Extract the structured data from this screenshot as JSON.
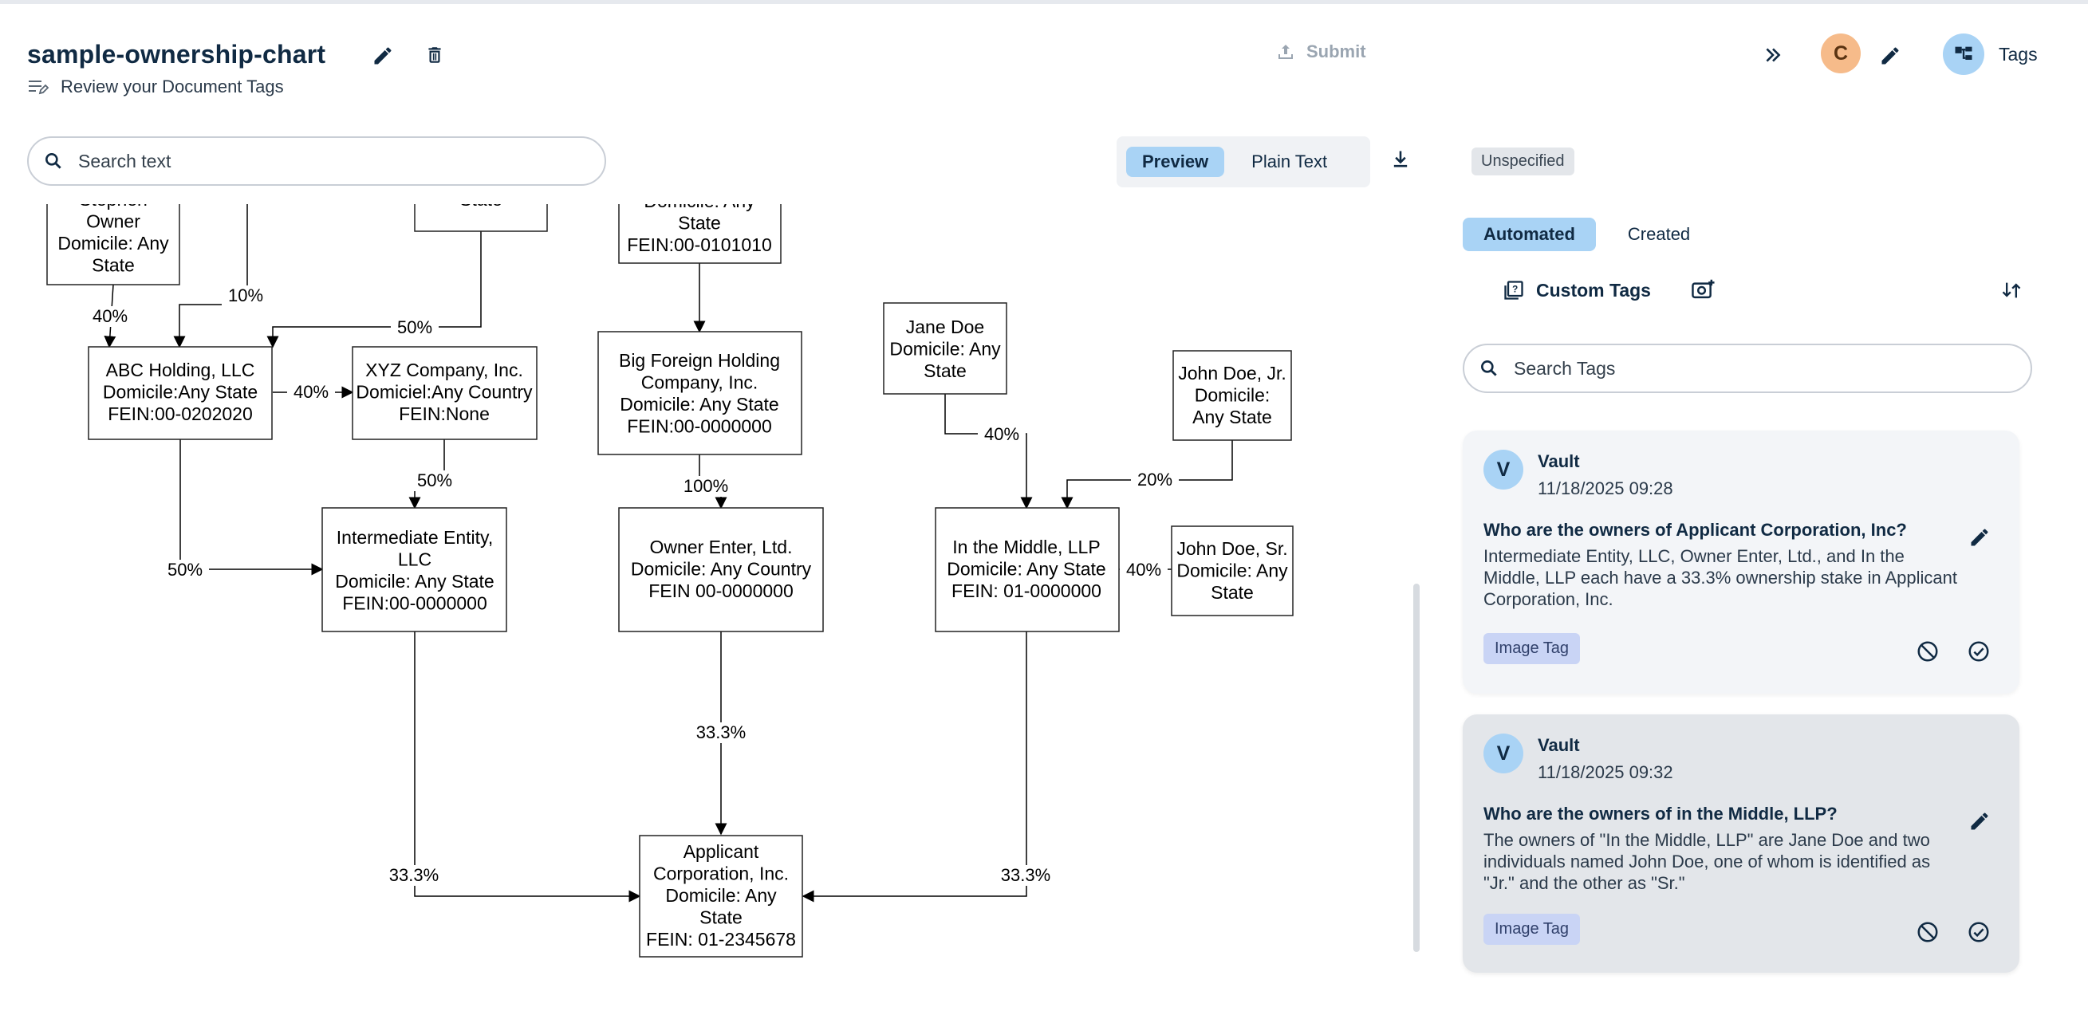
{
  "header": {
    "title": "sample-ownership-chart",
    "review_label": "Review your Document Tags",
    "submit_label": "Submit",
    "avatar_initial": "C",
    "tags_label": "Tags"
  },
  "toolbar": {
    "search_placeholder": "Search text",
    "preview_label": "Preview",
    "plain_text_label": "Plain Text"
  },
  "chart": {
    "boxes": {
      "stephen": [
        "Stephen",
        "Owner",
        "Domicile: Any",
        "State"
      ],
      "top_mid": [
        "State"
      ],
      "top_foreign": [
        "Domicile: Any",
        "State",
        "FEIN:00-0101010"
      ],
      "abc": [
        "ABC Holding, LLC",
        "Domicile:Any State",
        "FEIN:00-0202020"
      ],
      "xyz": [
        "XYZ Company, Inc.",
        "Domiciel:Any Country",
        "FEIN:None"
      ],
      "big_foreign": [
        "Big Foreign Holding",
        "Company, Inc.",
        "Domicile: Any State",
        "FEIN:00-0000000"
      ],
      "jane": [
        "Jane Doe",
        "Domicile: Any",
        "State"
      ],
      "john_jr": [
        "John Doe, Jr.",
        "Domicile:",
        "Any State"
      ],
      "intermediate": [
        "Intermediate Entity,",
        "LLC",
        "Domicile: Any State",
        "FEIN:00-0000000"
      ],
      "owner_enter": [
        "Owner Enter, Ltd.",
        "Domicile: Any Country",
        "FEIN 00-0000000"
      ],
      "middle": [
        "In the Middle, LLP",
        "Domicile: Any State",
        "FEIN: 01-0000000"
      ],
      "john_sr": [
        "John Doe, Sr.",
        "Domicile: Any",
        "State"
      ],
      "applicant": [
        "Applicant",
        "Corporation, Inc.",
        "Domicile: Any",
        "State",
        "FEIN: 01-2345678"
      ]
    },
    "labels": {
      "stephen_abc": "40%",
      "ten_abc": "10%",
      "top_xyz": "50%",
      "abc_xyz": "40%",
      "xyz_inter": "50%",
      "abc_inter": "50%",
      "foreign_owner": "100%",
      "jane_middle": "40%",
      "jr_middle": "20%",
      "sr_middle": "40%",
      "owner_app": "33.3%",
      "inter_app": "33.3%",
      "middle_app": "33.3%"
    }
  },
  "panel": {
    "badge": "Unspecified",
    "tabs": [
      "Automated",
      "Created"
    ],
    "custom_tags_label": "Custom Tags",
    "search_tags_placeholder": "Search Tags",
    "cards": [
      {
        "avatar": "V",
        "author": "Vault",
        "date": "11/18/2025 09:28",
        "question": "Who are the owners of Applicant Corporation, Inc?",
        "answer": "Intermediate Entity, LLC, Owner Enter, Ltd., and In the Middle, LLP each have a 33.3% ownership stake in Applicant Corporation, Inc.",
        "tag": "Image Tag"
      },
      {
        "avatar": "V",
        "author": "Vault",
        "date": "11/18/2025 09:32",
        "question": "Who are the owners of in the Middle, LLP?",
        "answer": "The owners of \"In the Middle, LLP\" are Jane Doe and two individuals named John Doe, one of whom is identified as \"Jr.\" and the other as \"Sr.\"",
        "tag": "Image Tag"
      }
    ]
  },
  "colors": {
    "accent": "#a9d3f5",
    "avatar_user": "#f6bb8a",
    "image_tag": "#c9d4f5"
  }
}
